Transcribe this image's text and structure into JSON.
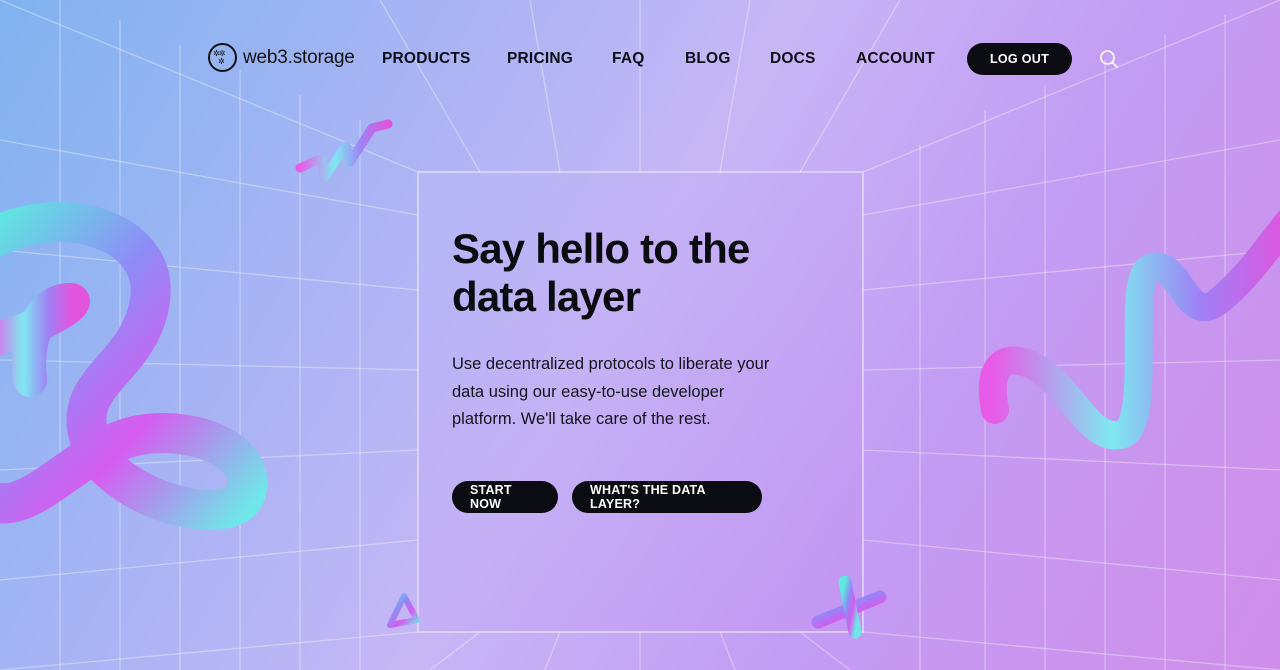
{
  "header": {
    "logo_text": "web3.storage",
    "nav": [
      "PRODUCTS",
      "PRICING",
      "FAQ",
      "BLOG",
      "DOCS",
      "ACCOUNT"
    ],
    "logout_label": "LOG OUT"
  },
  "hero": {
    "title_line1": "Say hello to the",
    "title_line2": "data layer",
    "description": "Use decentralized protocols to liberate your data using our easy-to-use developer platform. We'll take care of the rest.",
    "primary_cta": "START NOW",
    "secondary_cta": "WHAT'S THE DATA LAYER?"
  },
  "colors": {
    "button_bg": "#0b0b12",
    "text": "#0b0b12"
  },
  "icons": [
    "logo-icon",
    "search-icon"
  ]
}
